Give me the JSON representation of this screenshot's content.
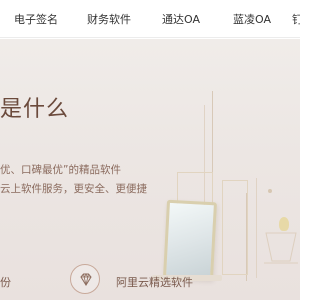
{
  "nav": {
    "items": [
      "电子签名",
      "财务软件",
      "通达OA",
      "蓝凌OA",
      "钉"
    ]
  },
  "hero": {
    "title": "是什么",
    "line1": "优、口碑最优”的精品软件",
    "line2": "云上软件服务，更安全、更便捷"
  },
  "features": {
    "left_label": "份",
    "right_label": "阿里云精选软件",
    "icon": "diamond-icon"
  },
  "colors": {
    "accent_brown": "#7a5a4d",
    "hero_bg": "#ece6e3",
    "nav_bg": "#ffffff"
  }
}
